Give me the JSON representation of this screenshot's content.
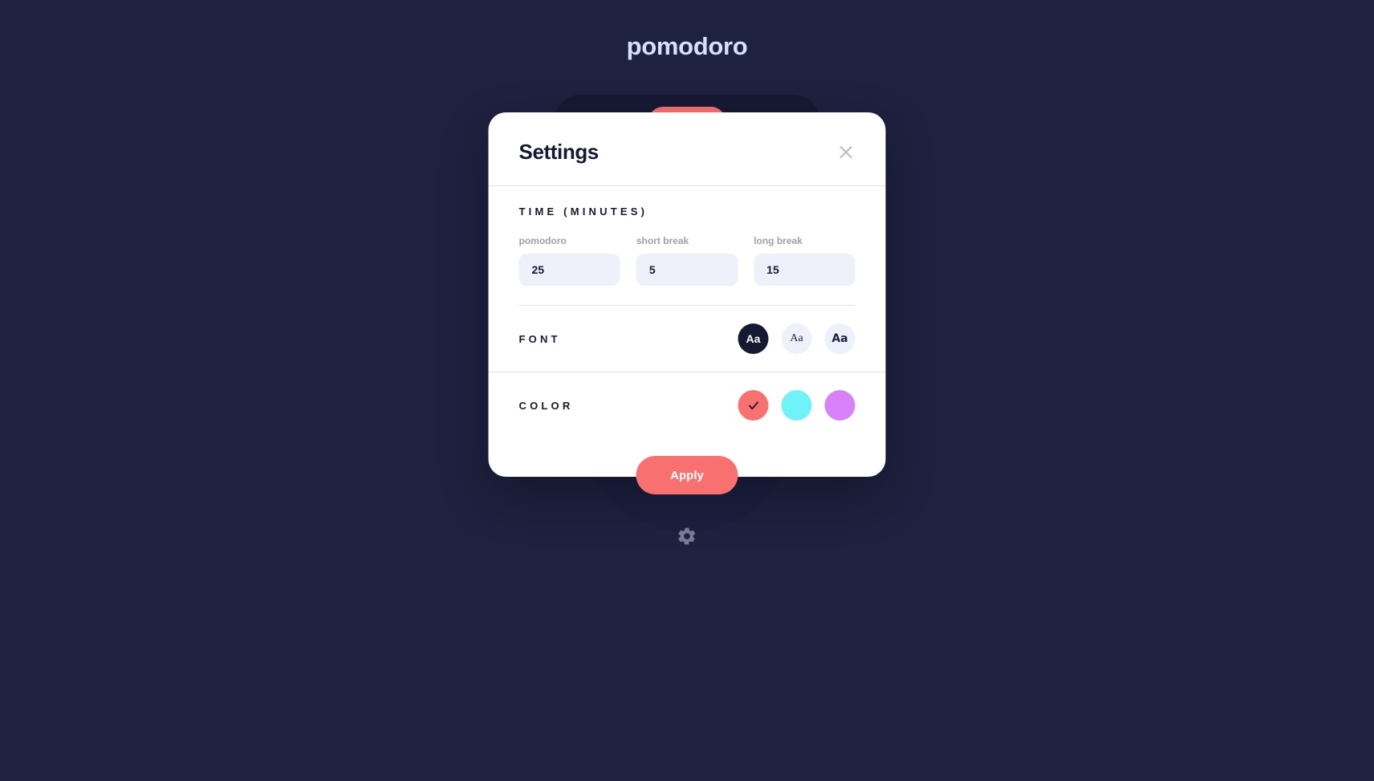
{
  "app": {
    "title": "pomodoro",
    "gear_icon": "gear-icon"
  },
  "modal": {
    "title": "Settings",
    "close_icon": "close-icon",
    "time_section": {
      "label": "TIME (MINUTES)",
      "fields": [
        {
          "label": "pomodoro",
          "value": "25"
        },
        {
          "label": "short break",
          "value": "5"
        },
        {
          "label": "long break",
          "value": "15"
        }
      ]
    },
    "font_section": {
      "label": "FONT",
      "options": [
        {
          "sample": "Aa",
          "style": "sans",
          "selected": true
        },
        {
          "sample": "Aa",
          "style": "serif",
          "selected": false
        },
        {
          "sample": "Aa",
          "style": "mono",
          "selected": false
        }
      ]
    },
    "color_section": {
      "label": "COLOR",
      "options": [
        {
          "color": "#F87070",
          "selected": true
        },
        {
          "color": "#70F3F8",
          "selected": false
        },
        {
          "color": "#D881F8",
          "selected": false
        }
      ],
      "check_icon": "check-icon"
    },
    "apply_label": "Apply"
  },
  "theme": {
    "background": "#1E213F",
    "card": "#161932",
    "accent": "#F87070",
    "text_light": "#D7E0FF",
    "text_dark": "#161932",
    "muted": "#9E9FAD",
    "field_bg": "#EFF1FA"
  }
}
